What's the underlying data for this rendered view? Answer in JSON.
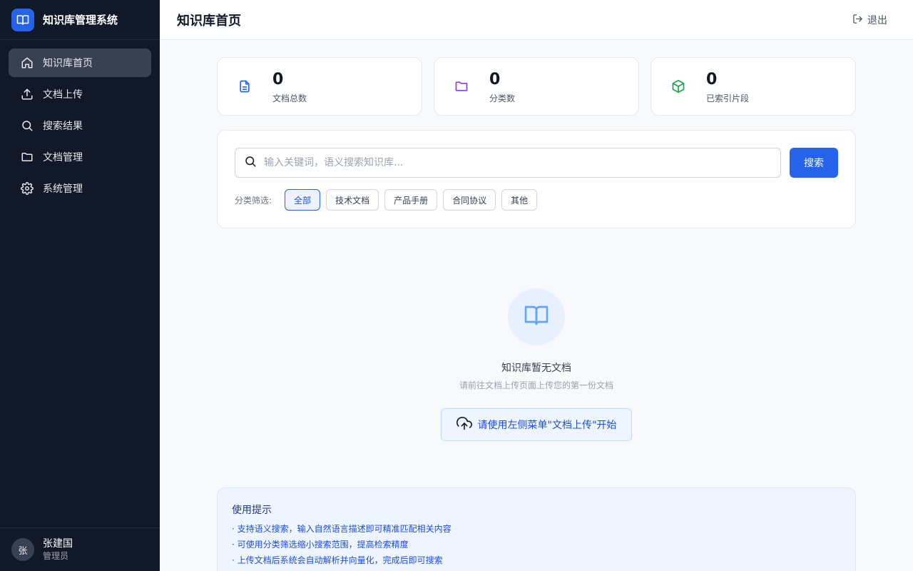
{
  "app": {
    "title": "知识库管理系统"
  },
  "sidebar": {
    "items": [
      {
        "label": "知识库首页",
        "icon": "home-icon",
        "active": true
      },
      {
        "label": "文档上传",
        "icon": "upload-icon",
        "active": false
      },
      {
        "label": "搜索结果",
        "icon": "search-icon",
        "active": false
      },
      {
        "label": "文档管理",
        "icon": "folder-icon",
        "active": false
      },
      {
        "label": "系统管理",
        "icon": "gear-icon",
        "active": false
      }
    ],
    "user": {
      "avatar_text": "张",
      "name": "张建国",
      "role": "管理员"
    }
  },
  "header": {
    "title": "知识库首页",
    "logout_label": "退出"
  },
  "stats": [
    {
      "value": "0",
      "label": "文档总数",
      "icon": "document-icon",
      "color": "#2563eb"
    },
    {
      "value": "0",
      "label": "分类数",
      "icon": "folder-icon",
      "color": "#9333ea"
    },
    {
      "value": "0",
      "label": "已索引片段",
      "icon": "cube-icon",
      "color": "#16a34a"
    }
  ],
  "search": {
    "placeholder": "输入关键词，语义搜索知识库...",
    "value": "",
    "button_label": "搜索",
    "filter_label": "分类筛选:",
    "filters": [
      {
        "label": "全部",
        "active": true
      },
      {
        "label": "技术文档",
        "active": false
      },
      {
        "label": "产品手册",
        "active": false
      },
      {
        "label": "合同协议",
        "active": false
      },
      {
        "label": "其他",
        "active": false
      }
    ]
  },
  "empty": {
    "title": "知识库暂无文档",
    "subtitle": "请前往文档上传页面上传您的第一份文档",
    "button_label": "请使用左侧菜单\"文档上传\"开始"
  },
  "tips": {
    "title": "使用提示",
    "items": [
      "· 支持语义搜索，输入自然语言描述即可精准匹配相关内容",
      "· 可使用分类筛选缩小搜索范围，提高检索精度",
      "· 上传文档后系统会自动解析并向量化，完成后即可搜索"
    ]
  },
  "colors": {
    "accent": "#2563eb",
    "sidebar_bg": "#111827"
  }
}
